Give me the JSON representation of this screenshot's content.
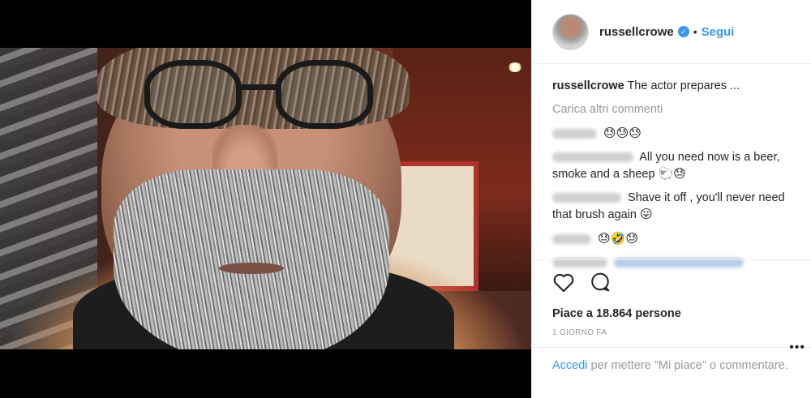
{
  "post": {
    "username": "russellcrowe",
    "follow_label": "Segui",
    "dot": "•",
    "caption_text": "The actor prepares ...",
    "load_more": "Carica altri commenti"
  },
  "comments": [
    {
      "text": "",
      "emojis": "😓😓😓"
    },
    {
      "text": "All you need now is a beer, smoke and a sheep",
      "emojis": "🐑😓"
    },
    {
      "text": "Shave it off , you'll never need that brush again",
      "emojis": "😛"
    },
    {
      "text": "",
      "emojis": "😓🤣😓"
    },
    {
      "text": "",
      "emojis": ""
    }
  ],
  "likes_text": "Piace a 18.864 persone",
  "time_text": "1 GIORNO FA",
  "footer": {
    "login_link": "Accedi",
    "rest": " per mettere \"Mi piace\" o commentare.",
    "more": "•••"
  },
  "colors": {
    "accent": "#3897f0",
    "muted": "#999999",
    "text": "#262626"
  },
  "icons": [
    "heart-icon",
    "comment-icon",
    "verified-icon"
  ]
}
